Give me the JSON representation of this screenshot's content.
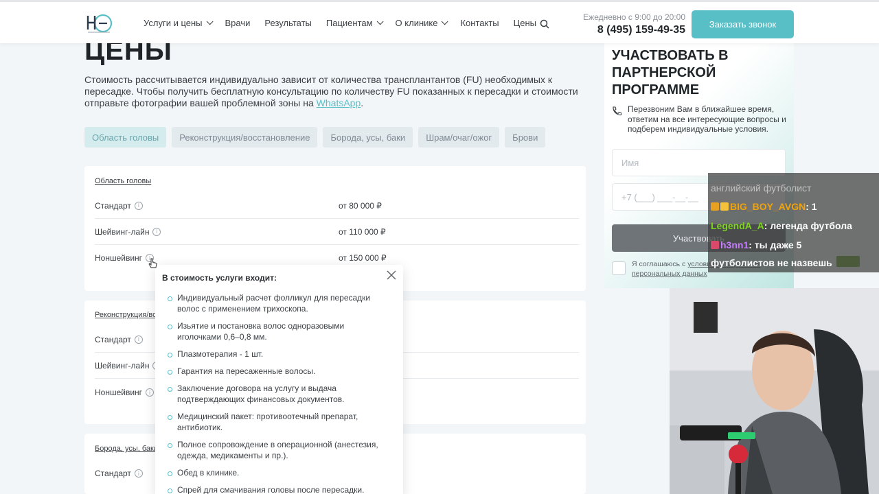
{
  "header": {
    "nav": [
      {
        "label": "Услуги и цены",
        "dropdown": true
      },
      {
        "label": "Врачи",
        "dropdown": false
      },
      {
        "label": "Результаты",
        "dropdown": false
      },
      {
        "label": "Пациентам",
        "dropdown": true
      },
      {
        "label": "О клинике",
        "dropdown": true
      },
      {
        "label": "Контакты",
        "dropdown": false
      },
      {
        "label": "Цены",
        "dropdown": false
      }
    ],
    "hours": "Ежедневно с 9:00 до 20:00",
    "phone": "8 (495) 159-49-35",
    "call_button": "Заказать звонок"
  },
  "main": {
    "title": "ЦЕНЫ",
    "intro_text": "Стоимость рассчитывается индивидуально зависит от количества трансплантантов (FU) необходимых к пересадке. Чтобы получить бесплатную консультацию по количеству FU показанных к пересадки и стоимости отправьте фотографии вашей проблемной зоны на ",
    "intro_link": "WhatsApp",
    "intro_end": ".",
    "tabs": [
      {
        "label": "Область головы",
        "active": true
      },
      {
        "label": "Реконструкция/восстановление",
        "active": false
      },
      {
        "label": "Борода, усы, баки",
        "active": false
      },
      {
        "label": "Шрам/очаг/ожог",
        "active": false
      },
      {
        "label": "Брови",
        "active": false
      }
    ],
    "sections": [
      {
        "heading": "Область головы",
        "rows": [
          {
            "name": "Стандарт",
            "price": "от 80 000 ₽"
          },
          {
            "name": "Шейвинг-лайн",
            "price": "от 110 000 ₽"
          },
          {
            "name": "Ноншейвинг",
            "price": "от 150 000 ₽"
          }
        ]
      },
      {
        "heading": "Реконструкция/во",
        "rows": [
          {
            "name": "Стандарт"
          },
          {
            "name": "Шейвинг-лайн"
          },
          {
            "name": "Ноншейвинг"
          }
        ]
      },
      {
        "heading": "Борода, усы, баки",
        "rows": [
          {
            "name": "Стандарт"
          }
        ]
      }
    ]
  },
  "popover": {
    "title": "В стоимость услуги входит:",
    "items": [
      "Индивидуальный расчет фолликул для пересадки волос с применением трихоскопа.",
      "Изьятие и постановка волос одноразовыми иголочками 0,6–0,8 мм.",
      "Плазмотерапия - 1 шт.",
      "Гарантия на пересаженные волосы.",
      "Заключение договора на услугу и выдача подтверждающих финансовых документов.",
      "Медицинский пакет: противоотечный препарат, антибиотик.",
      "Полное сопровождение в операционной (анестезия, одежда, медикаменты и пр.).",
      "Обед в клинике.",
      "Спрей для смачивания головы после пересадки."
    ]
  },
  "side_panel": {
    "title": "УЧАСТВОВАТЬ В ПАРТНЕРСКОЙ ПРОГРАММЕ",
    "callback_text": "Перезвоним Вам в ближайшее время, ответим на все интересующие вопросы и подберем индивидуальные условия.",
    "name_placeholder": "Имя",
    "phone_placeholder": "+7 (___) ___-__-__",
    "submit_label": "Участвовать",
    "agree_text": "Я соглашаюсь с ",
    "agree_link": "условиями обработки",
    "agree_tail": "персональных данных"
  },
  "chat": {
    "messages": [
      {
        "user": "",
        "text": "английский футболист",
        "faded": true
      },
      {
        "user": "BIG_BOY_AVGN",
        "text": ": 1",
        "color": "#f0a30a"
      },
      {
        "user": "LegendA_A",
        "text": ": легенда футбола",
        "color": "#7ed321"
      },
      {
        "user": "h3nn1",
        "text": ": ты даже 5",
        "color": "#c77dff"
      },
      {
        "user": "",
        "text": "футболистов не назвешь",
        "faded": false
      }
    ]
  },
  "colors": {
    "accent": "#59bfc7",
    "submit_bg": "#6f7478"
  }
}
